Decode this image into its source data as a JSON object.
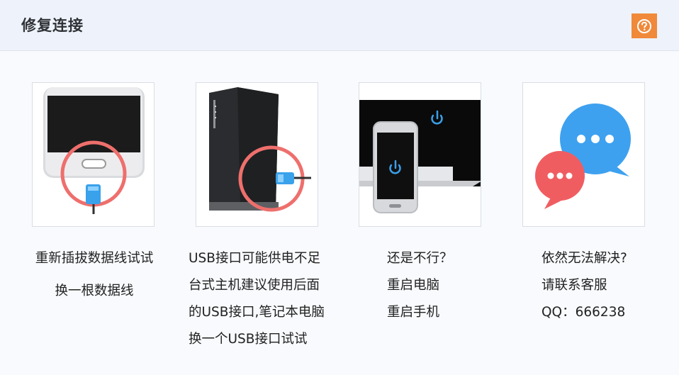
{
  "header": {
    "title": "修复连接",
    "help_icon": "question-circle-icon",
    "accent_color": "#f0893a"
  },
  "cards": [
    {
      "image": "phone-usb-port-illustration",
      "lines": [
        "重新插拔数据线试试",
        "换一根数据线"
      ]
    },
    {
      "image": "desktop-tower-usb-illustration",
      "lines": [
        "USB接口可能供电不足",
        "台式主机建议使用后面",
        "的USB接口,笔记本电脑",
        "换一个USB接口试试"
      ]
    },
    {
      "image": "phone-laptop-restart-illustration",
      "lines": [
        "还是不行？",
        "重启电脑",
        "重启手机"
      ]
    },
    {
      "image": "chat-bubbles-illustration",
      "lines": [
        "依然无法解决?",
        "请联系客服",
        "QQ：666238"
      ]
    }
  ]
}
